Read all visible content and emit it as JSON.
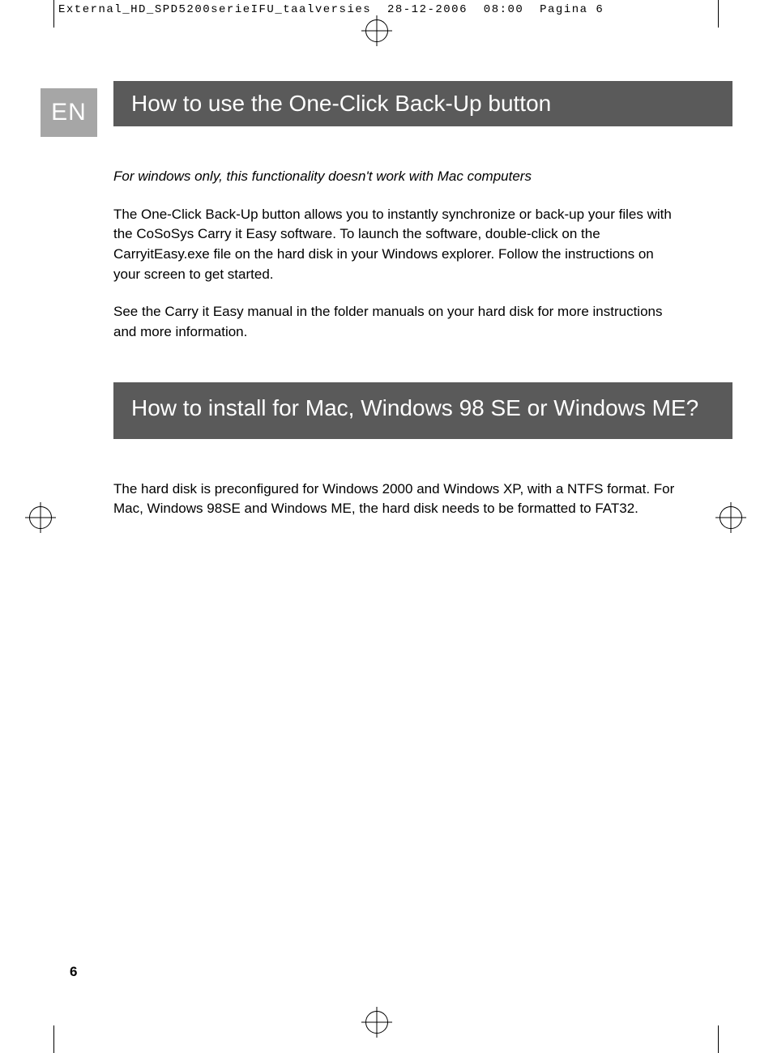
{
  "header": {
    "filename": "External_HD_SPD5200serieIFU_taalversies",
    "date": "28-12-2006",
    "time": "08:00",
    "pagina": "Pagina 6"
  },
  "language_badge": "EN",
  "section1": {
    "title": "How to use the One-Click Back-Up button",
    "note": "For windows only, this functionality doesn't work with Mac computers",
    "paragraph1": "The One-Click Back-Up button allows you to instantly synchronize or back-up your files with the CoSoSys Carry it Easy software. To launch the software, double-click on the CarryitEasy.exe file on the hard disk in your Windows explorer. Follow the instructions on your screen to get started.",
    "paragraph2": "See the Carry it Easy manual in the folder manuals on your hard disk for more instructions and more information."
  },
  "section2": {
    "title": "How to install for Mac, Windows 98 SE or Windows ME?",
    "paragraph1": "The hard disk is preconfigured for Windows 2000 and Windows XP, with a NTFS format. For Mac, Windows 98SE and Windows ME, the hard disk needs to be formatted to FAT32."
  },
  "page_number": "6"
}
